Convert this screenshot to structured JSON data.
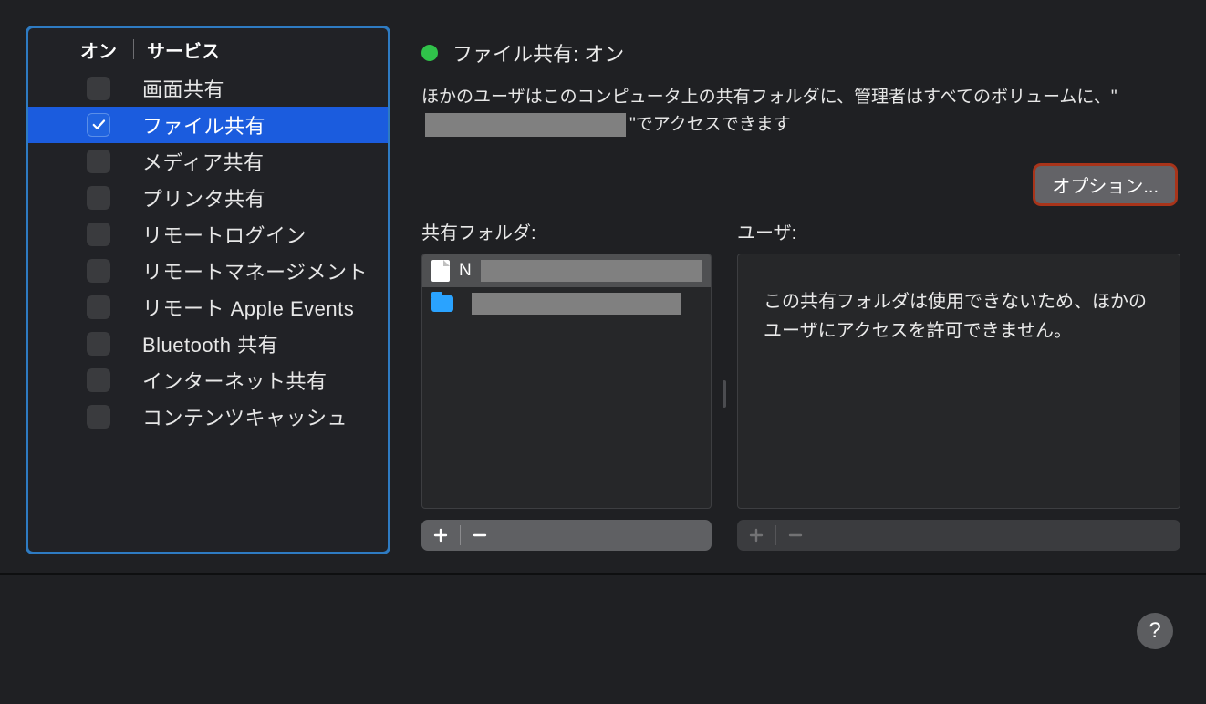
{
  "sidebar": {
    "header_on": "オン",
    "header_service": "サービス",
    "items": [
      {
        "label": "画面共有"
      },
      {
        "label": "ファイル共有"
      },
      {
        "label": "メディア共有"
      },
      {
        "label": "プリンタ共有"
      },
      {
        "label": "リモートログイン"
      },
      {
        "label": "リモートマネージメント"
      },
      {
        "label": "リモート Apple Events"
      },
      {
        "label": "Bluetooth 共有"
      },
      {
        "label": "インターネット共有"
      },
      {
        "label": "コンテンツキャッシュ"
      }
    ]
  },
  "main": {
    "status_title": "ファイル共有: オン",
    "desc_part1": "ほかのユーザはこのコンピュータ上の共有フォルダに、管理者はすべてのボリュームに、",
    "desc_quote": "\"",
    "desc_part2": "でアクセスできます",
    "options_button": "オプション...",
    "folders_title": "共有フォルダ:",
    "users_title": "ユーザ:",
    "folders": [
      {
        "icon": "doc",
        "text_prefix": "N"
      },
      {
        "icon": "folder",
        "text_prefix": ""
      }
    ],
    "users_message": "この共有フォルダは使用できないため、ほかのユーザにアクセスを許可できません。"
  },
  "footer": {
    "help": "?"
  }
}
